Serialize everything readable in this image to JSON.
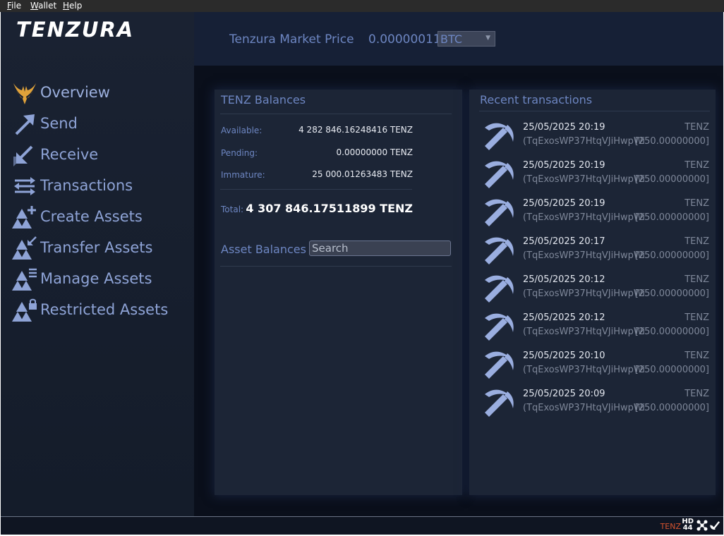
{
  "menu": {
    "file": "File",
    "wallet": "Wallet",
    "help": "Help"
  },
  "brand": {
    "logo_text": "TENZURA"
  },
  "nav": {
    "items": [
      {
        "label": "Overview",
        "icon": "tenzura-logo-icon"
      },
      {
        "label": "Send",
        "icon": "arrow-up-right-icon"
      },
      {
        "label": "Receive",
        "icon": "arrow-down-left-icon"
      },
      {
        "label": "Transactions",
        "icon": "transfer-arrows-icon"
      },
      {
        "label": "Create Assets",
        "icon": "asset-add-icon"
      },
      {
        "label": "Transfer Assets",
        "icon": "asset-transfer-icon"
      },
      {
        "label": "Manage Assets",
        "icon": "asset-manage-icon"
      },
      {
        "label": "Restricted Assets",
        "icon": "asset-lock-icon"
      }
    ]
  },
  "header": {
    "market_label": "Tenzura Market Price",
    "market_price": "0.00000011",
    "currency": "BTC"
  },
  "balances": {
    "title": "TENZ Balances",
    "available_label": "Available:",
    "available_value": "4 282 846.16248416 TENZ",
    "pending_label": "Pending:",
    "pending_value": "0.00000000 TENZ",
    "immature_label": "Immature:",
    "immature_value": "25 000.01263483 TENZ",
    "total_label": "Total:",
    "total_value": "4 307 846.17511899 TENZ"
  },
  "assets": {
    "title": "Asset Balances",
    "search_placeholder": "Search"
  },
  "recent": {
    "title": "Recent transactions",
    "transactions": [
      {
        "date": "25/05/2025 20:19",
        "unit": "TENZ",
        "address": "(TqExosWP37HtqVJiHwpWi1jUPH7rNjb5Kx)",
        "amount": "[250.00000000]",
        "icon": "mining-pickaxe-icon"
      },
      {
        "date": "25/05/2025 20:19",
        "unit": "TENZ",
        "address": "(TqExosWP37HtqVJiHwpWi1jUPH7rNjb5Kx)",
        "amount": "[250.00000000]",
        "icon": "mining-pickaxe-icon"
      },
      {
        "date": "25/05/2025 20:19",
        "unit": "TENZ",
        "address": "(TqExosWP37HtqVJiHwpWi1jUPH7rNjb5Kx)",
        "amount": "[250.00000000]",
        "icon": "mining-pickaxe-icon"
      },
      {
        "date": "25/05/2025 20:17",
        "unit": "TENZ",
        "address": "(TqExosWP37HtqVJiHwpWi1jUPH7rNjb5Kx)",
        "amount": "[250.00000000]",
        "icon": "mining-pickaxe-icon"
      },
      {
        "date": "25/05/2025 20:12",
        "unit": "TENZ",
        "address": "(TqExosWP37HtqVJiHwpWi1jUPH7rNjb5Kx)",
        "amount": "[250.00000000]",
        "icon": "mining-pickaxe-icon"
      },
      {
        "date": "25/05/2025 20:12",
        "unit": "TENZ",
        "address": "(TqExosWP37HtqVJiHwpWi1jUPH7rNjb5Kx)",
        "amount": "[250.00000000]",
        "icon": "mining-pickaxe-icon"
      },
      {
        "date": "25/05/2025 20:10",
        "unit": "TENZ",
        "address": "(TqExosWP37HtqVJiHwpWi1jUPH7rNjb5Kx)",
        "amount": "[250.00000000]",
        "icon": "mining-pickaxe-icon"
      },
      {
        "date": "25/05/2025 20:09",
        "unit": "TENZ",
        "address": "(TqExosWP37HtqVJiHwpWi1jUPH7rNjb5Kx)",
        "amount": "[250.00000000]",
        "icon": "mining-pickaxe-icon"
      }
    ]
  },
  "status": {
    "unit": "TENZ",
    "hd_top": "HD",
    "hd_bottom": "44",
    "icons": [
      "network-icon",
      "synced-check-icon"
    ]
  },
  "colors": {
    "accent_text": "#6d86c2",
    "logo_gold": "#e0a23a",
    "status_unit": "#d6542f"
  }
}
